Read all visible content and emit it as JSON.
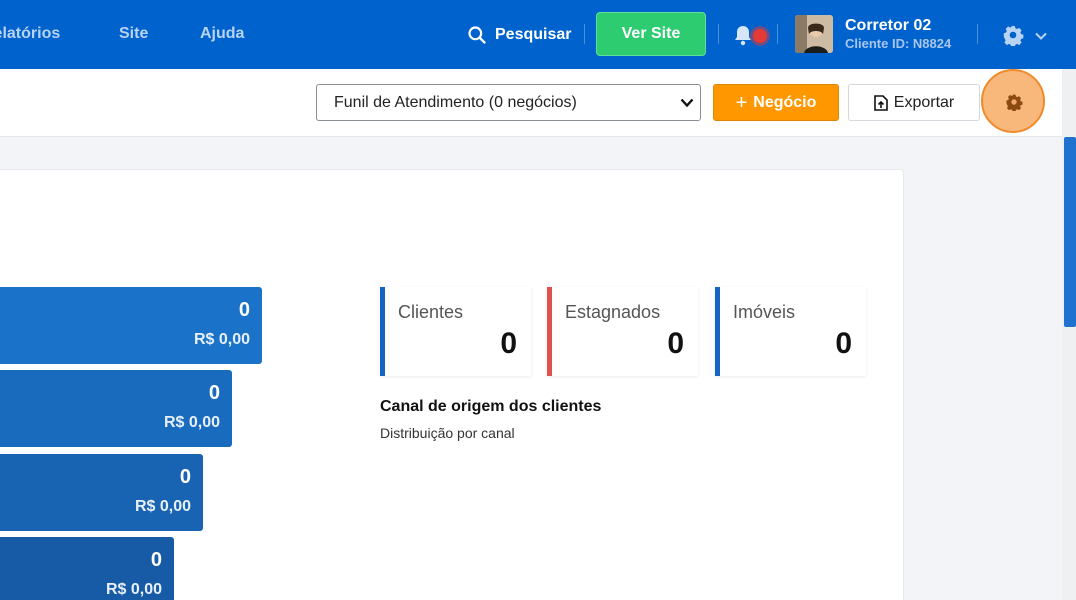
{
  "nav": {
    "links": [
      "Relatórios",
      "Site",
      "Ajuda"
    ],
    "search_label": "Pesquisar",
    "ver_site_label": "Ver Site",
    "user": {
      "name": "Corretor 02",
      "client_id": "Cliente ID: N8824"
    }
  },
  "toolbar": {
    "funnel_select_value": "Funil de Atendimento (0 negócios)",
    "negocio_label": "Negócio",
    "exportar_label": "Exportar"
  },
  "funnel": [
    {
      "count": "0",
      "value": "R$ 0,00",
      "color": "#1a73c9"
    },
    {
      "count": "0",
      "value": "R$ 0,00",
      "color": "#196bbd"
    },
    {
      "count": "0",
      "value": "R$ 0,00",
      "color": "#1863b2"
    },
    {
      "count": "0",
      "value": "R$ 0,00",
      "color": "#175aa6"
    }
  ],
  "stats": [
    {
      "label": "Clientes",
      "value": "0",
      "accent": "#1565c0"
    },
    {
      "label": "Estagnados",
      "value": "0",
      "accent": "#e05252"
    },
    {
      "label": "Imóveis",
      "value": "0",
      "accent": "#1565c0"
    }
  ],
  "channel_section": {
    "title": "Canal de origem dos clientes",
    "subtitle": "Distribuição por canal"
  },
  "icons": [
    "search-icon",
    "bell-icon",
    "gear-icon",
    "chevron-down-icon",
    "plus-icon",
    "export-file-icon"
  ],
  "colors": {
    "topbar": "#0062cc",
    "primary_green": "#2ecc71",
    "orange": "#ff9800",
    "notification": "#e53935"
  }
}
